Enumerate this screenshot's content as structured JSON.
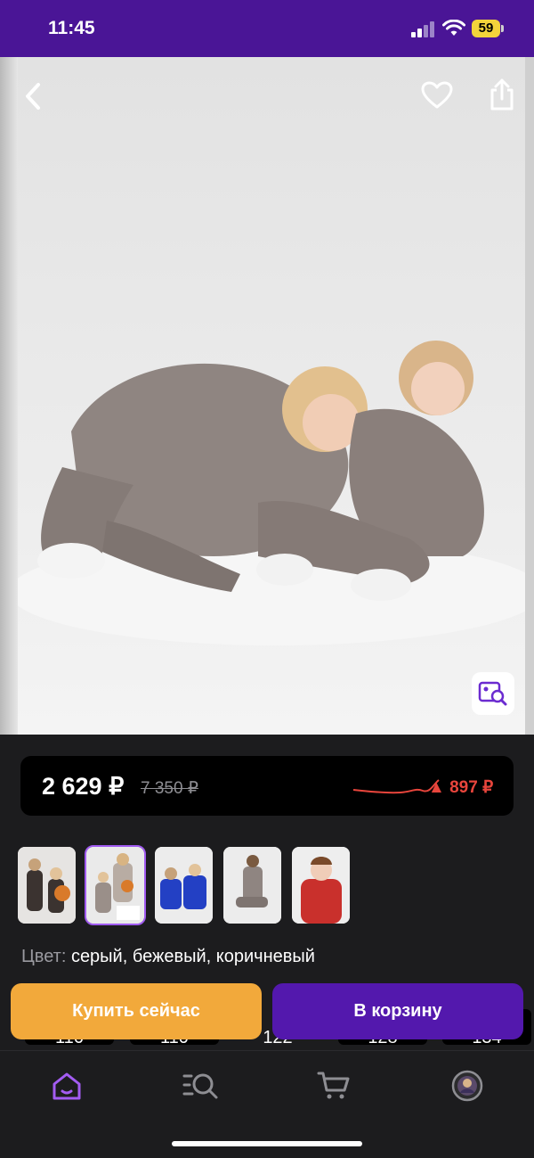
{
  "status_bar": {
    "time": "11:45",
    "battery": "59"
  },
  "product": {
    "price_current": "2 629 ₽",
    "price_old": "7 350 ₽",
    "price_change": "▲ 897 ₽",
    "color_label": "Цвет:",
    "color_value": "серый, бежевый, коричневый"
  },
  "gallery": {
    "thumbnails": [
      {
        "name": "thumbnail-1",
        "selected": false
      },
      {
        "name": "thumbnail-2",
        "selected": true
      },
      {
        "name": "thumbnail-3",
        "selected": false
      },
      {
        "name": "thumbnail-4",
        "selected": false
      },
      {
        "name": "thumbnail-5",
        "selected": false
      }
    ]
  },
  "sizes": [
    "116",
    "110",
    "122",
    "128",
    "134"
  ],
  "actions": {
    "buy_now": "Купить сейчас",
    "add_to_cart": "В корзину"
  },
  "tabbar": {
    "items": [
      "home",
      "catalog-search",
      "cart",
      "profile"
    ],
    "active": "home"
  },
  "colors": {
    "status_bar": "#4a1596",
    "accent_purple": "#5318ad",
    "buy_orange": "#f2a93b",
    "price_drop": "#e8453c",
    "active_tab": "#a35cf2"
  }
}
